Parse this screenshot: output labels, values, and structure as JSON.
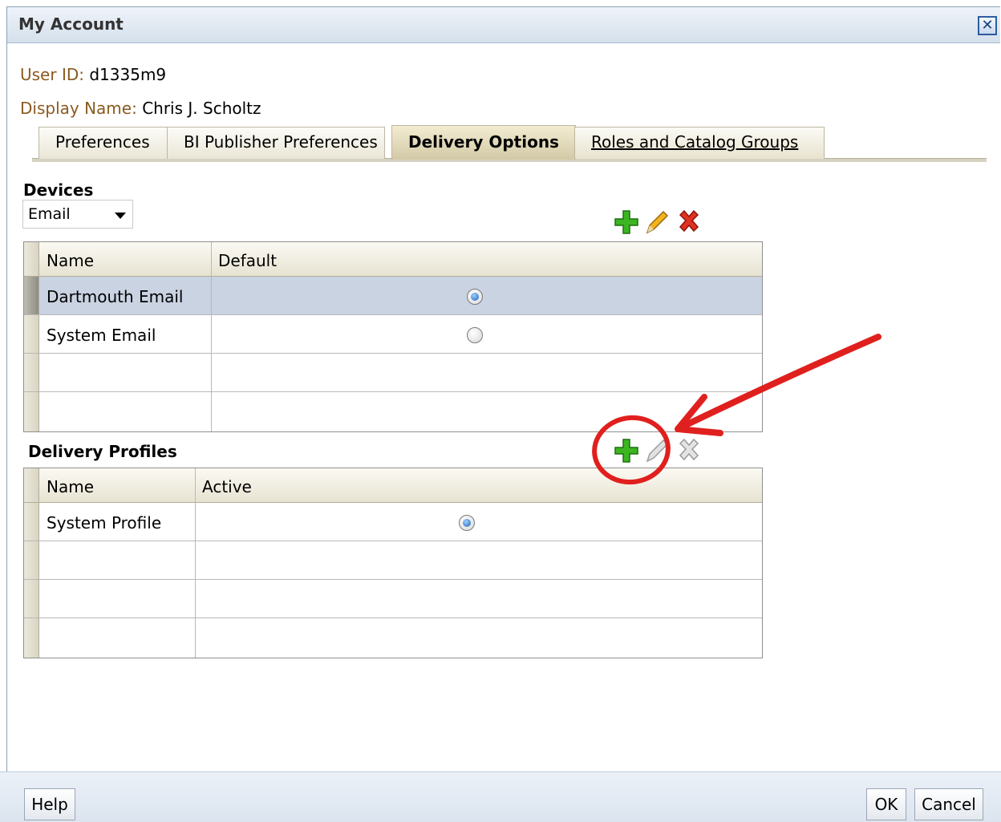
{
  "dialog": {
    "title": "My Account",
    "close_icon": "close-icon"
  },
  "user": {
    "id_label": "User ID:",
    "id_value": "d1335m9",
    "display_label": "Display Name:",
    "display_value": "Chris J. Scholtz"
  },
  "tabs": [
    {
      "label": "Preferences",
      "active": false
    },
    {
      "label": "BI Publisher Preferences",
      "active": false
    },
    {
      "label": "Delivery Options",
      "active": true
    },
    {
      "label": "Roles and Catalog Groups",
      "active": false
    }
  ],
  "devices": {
    "title": "Devices",
    "type_select": "Email",
    "toolbar": {
      "add_icon": "add-icon",
      "edit_icon": "edit-icon",
      "delete_icon": "delete-icon"
    },
    "columns": [
      "Name",
      "Default"
    ],
    "rows": [
      {
        "name": "Dartmouth Email",
        "default": true,
        "selected": true
      },
      {
        "name": "System Email",
        "default": false,
        "selected": false
      }
    ]
  },
  "profiles": {
    "title": "Delivery Profiles",
    "toolbar": {
      "add_icon": "add-icon",
      "edit_icon": "edit-icon-disabled",
      "delete_icon": "delete-icon-disabled"
    },
    "columns": [
      "Name",
      "Active"
    ],
    "rows": [
      {
        "name": "System Profile",
        "active": true
      }
    ]
  },
  "footer": {
    "help": "Help",
    "ok": "OK",
    "cancel": "Cancel"
  },
  "colors": {
    "annotation": "#e0201e",
    "add_green": "#2fa81a",
    "delete_red": "#d8281c"
  }
}
